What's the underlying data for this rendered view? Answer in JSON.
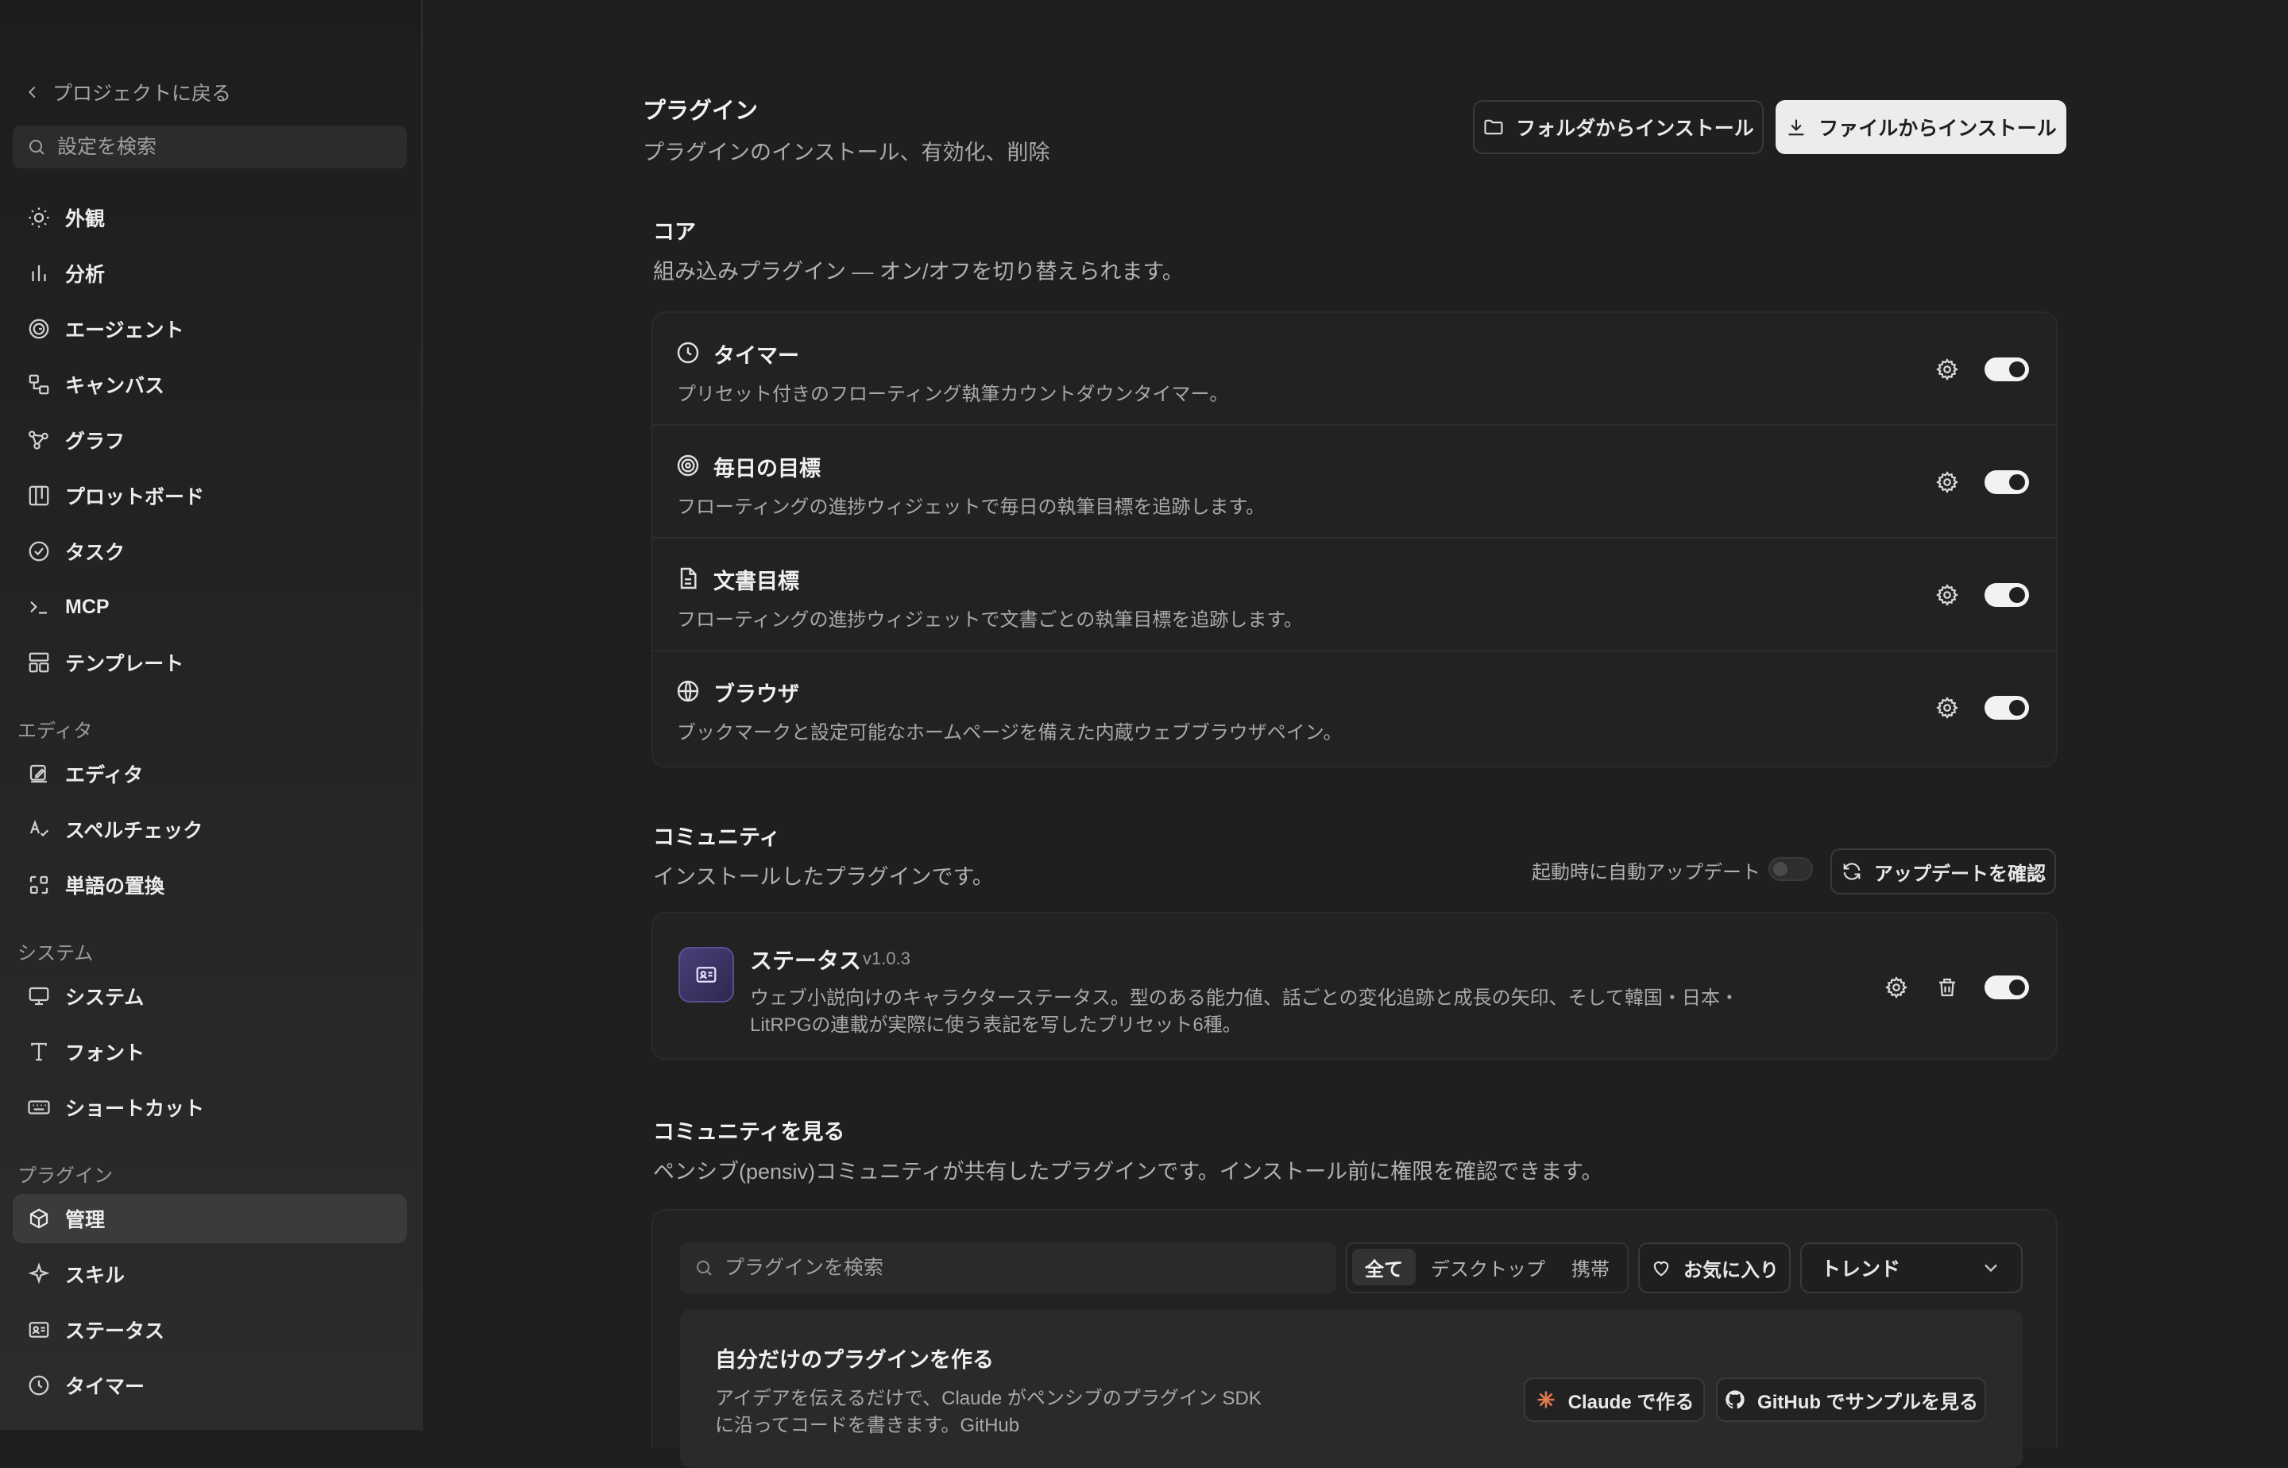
{
  "sidebar": {
    "back_label": "プロジェクトに戻る",
    "search_placeholder": "設定を検索",
    "items": [
      {
        "label": "外観",
        "icon": "sun-icon"
      },
      {
        "label": "分析",
        "icon": "bar-chart-icon"
      },
      {
        "label": "エージェント",
        "icon": "spiral-icon"
      },
      {
        "label": "キャンバス",
        "icon": "canvas-icon"
      },
      {
        "label": "グラフ",
        "icon": "graph-icon"
      },
      {
        "label": "プロットボード",
        "icon": "board-icon"
      },
      {
        "label": "タスク",
        "icon": "check-circle-icon"
      },
      {
        "label": "MCP",
        "icon": "terminal-icon"
      },
      {
        "label": "テンプレート",
        "icon": "template-icon"
      }
    ],
    "section_editor": "エディタ",
    "editor_items": [
      {
        "label": "エディタ",
        "icon": "edit-icon"
      },
      {
        "label": "スペルチェック",
        "icon": "spellcheck-icon"
      },
      {
        "label": "単語の置換",
        "icon": "replace-icon"
      }
    ],
    "section_system": "システム",
    "system_items": [
      {
        "label": "システム",
        "icon": "monitor-icon"
      },
      {
        "label": "フォント",
        "icon": "type-icon"
      },
      {
        "label": "ショートカット",
        "icon": "keyboard-icon"
      }
    ],
    "section_plugins": "プラグイン",
    "plugin_items": [
      {
        "label": "管理",
        "icon": "box-icon",
        "active": true
      },
      {
        "label": "スキル",
        "icon": "sparkle-icon"
      },
      {
        "label": "ステータス",
        "icon": "id-card-icon"
      },
      {
        "label": "タイマー",
        "icon": "clock-icon"
      }
    ]
  },
  "header": {
    "title": "プラグイン",
    "description": "プラグインのインストール、有効化、削除",
    "install_folder_label": "フォルダからインストール",
    "install_file_label": "ファイルからインストール"
  },
  "core": {
    "title": "コア",
    "description": "組み込みプラグイン — オン/オフを切り替えられます。",
    "plugins": [
      {
        "name": "タイマー",
        "desc": "プリセット付きのフローティング執筆カウントダウンタイマー。",
        "icon": "clock-icon",
        "enabled": true
      },
      {
        "name": "毎日の目標",
        "desc": "フローティングの進捗ウィジェットで毎日の執筆目標を追跡します。",
        "icon": "target-icon",
        "enabled": true
      },
      {
        "name": "文書目標",
        "desc": "フローティングの進捗ウィジェットで文書ごとの執筆目標を追跡します。",
        "icon": "document-icon",
        "enabled": true
      },
      {
        "name": "ブラウザ",
        "desc": "ブックマークと設定可能なホームページを備えた内蔵ウェブブラウザペイン。",
        "icon": "globe-icon",
        "enabled": true
      }
    ]
  },
  "community": {
    "title": "コミュニティ",
    "description": "インストールしたプラグインです。",
    "auto_update_label": "起動時に自動アップデート",
    "auto_update_enabled": false,
    "check_updates_label": "アップデートを確認",
    "plugin": {
      "name": "ステータス",
      "version": "v1.0.3",
      "desc_line1": "ウェブ小説向けのキャラクターステータス。型のある能力値、話ごとの変化追跡と成長の矢印、そして韓国・日本・",
      "desc_line2": "LitRPGの連載が実際に使う表記を写したプリセット6種。",
      "enabled": true
    }
  },
  "browse": {
    "title": "コミュニティを見る",
    "description": "ペンシブ(pensiv)コミュニティが共有したプラグインです。インストール前に権限を確認できます。",
    "search_placeholder": "プラグインを検索",
    "filters": [
      "全て",
      "デスクトップ",
      "携帯"
    ],
    "active_filter": "全て",
    "favorites_label": "お気に入り",
    "sort_value": "トレンド",
    "create": {
      "title": "自分だけのプラグインを作る",
      "desc_line1": "アイデアを伝えるだけで、Claude がペンシブのプラグイン SDK",
      "desc_line2": "に沿ってコードを書きます。GitHub",
      "claude_button": "Claude で作る",
      "github_button": "GitHub でサンプルを見る"
    }
  }
}
